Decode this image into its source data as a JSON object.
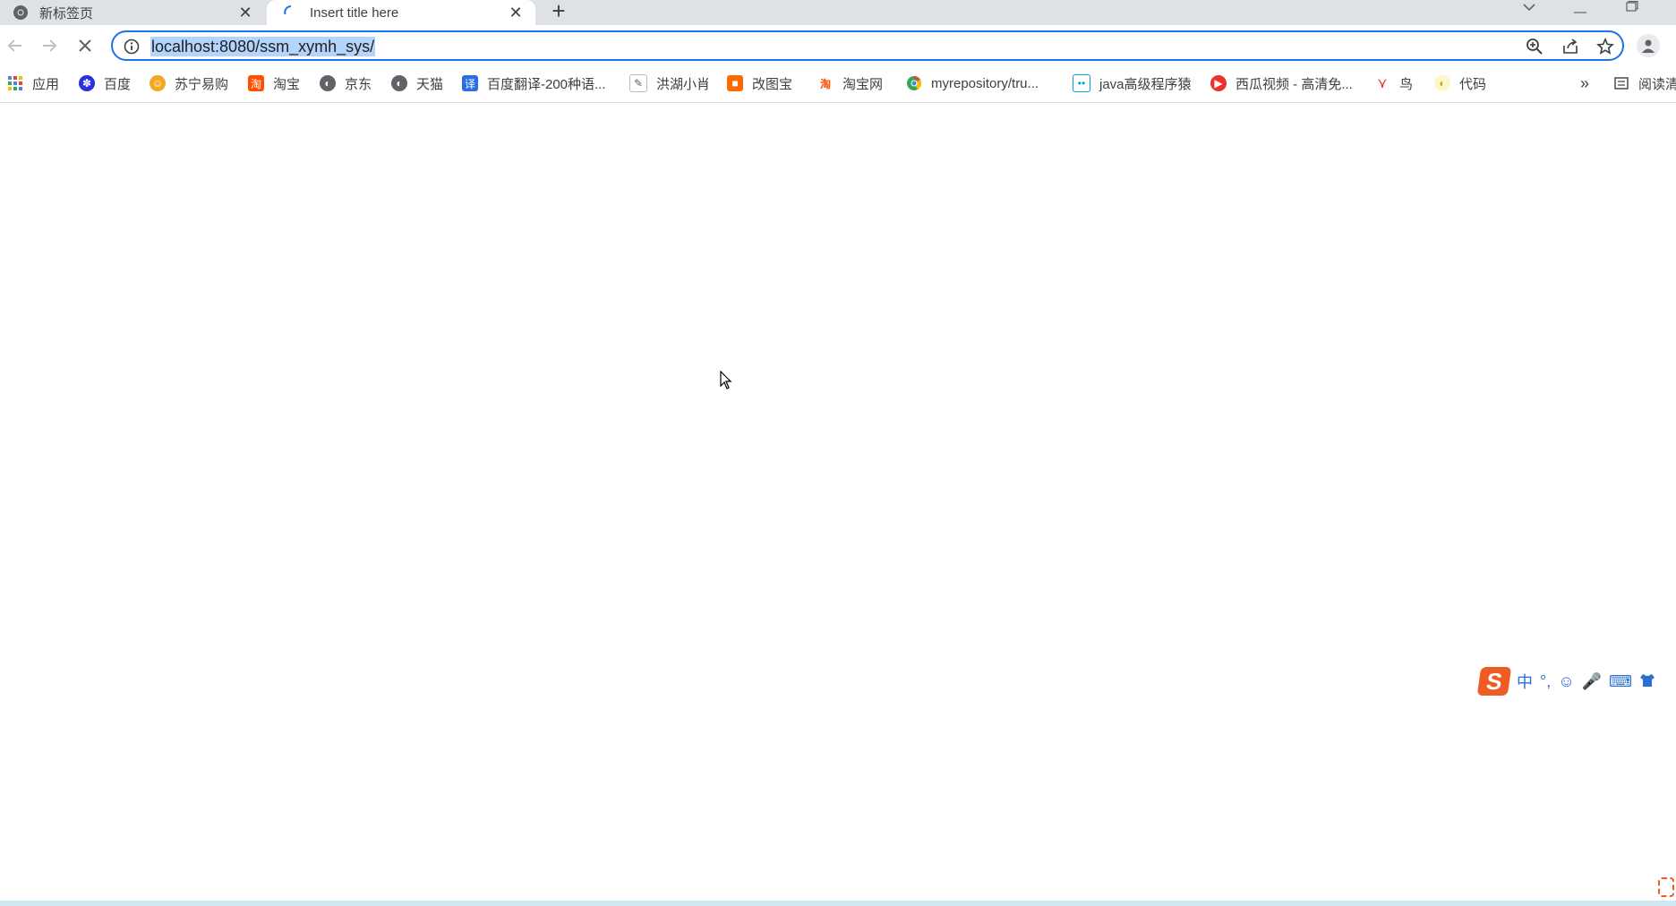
{
  "tabs": [
    {
      "title": "新标签页",
      "close": "✕"
    },
    {
      "title": "Insert title here",
      "close": "✕"
    }
  ],
  "new_tab": "+",
  "address_bar": {
    "url": "localhost:8080/ssm_xymh_sys/"
  },
  "bookmarks": [
    {
      "label": "应用",
      "icon": "apps-grid-icon",
      "color": "#4285f4"
    },
    {
      "label": "百度",
      "icon": "baidu-paw-icon",
      "color": "#2932e1"
    },
    {
      "label": "苏宁易购",
      "icon": "suning-icon",
      "color": "#f5a623"
    },
    {
      "label": "淘宝",
      "icon": "taobao-icon",
      "color": "#ff5000"
    },
    {
      "label": "京东",
      "icon": "globe-icon",
      "color": "#5f6368"
    },
    {
      "label": "天猫",
      "icon": "globe-icon",
      "color": "#5f6368"
    },
    {
      "label": "百度翻译-200种语...",
      "icon": "translate-icon",
      "color": "#2b6de5"
    },
    {
      "label": "洪湖小肖",
      "icon": "pen-icon",
      "color": "#5f6368"
    },
    {
      "label": "改图宝",
      "icon": "gaitubao-icon",
      "color": "#ff6a00"
    },
    {
      "label": "淘宝网",
      "icon": "taobao-tao-icon",
      "color": "#ff5000"
    },
    {
      "label": "myrepository/tru...",
      "icon": "chrome-icon",
      "color": "#34a853"
    },
    {
      "label": "java高级程序猿",
      "icon": "bilibili-icon",
      "color": "#00a1d6"
    },
    {
      "label": "西瓜视频 - 高清免...",
      "icon": "xigua-play-icon",
      "color": "#f0302b"
    },
    {
      "label": "鸟",
      "icon": "bird-icon",
      "color": "#e53935"
    },
    {
      "label": "代码",
      "icon": "code-icon",
      "color": "#e8c14a"
    }
  ],
  "bookmarks_more": "»",
  "reading_list": "阅读清",
  "ime_toolbar": {
    "logo": "S",
    "items": [
      "中",
      "°,",
      "☺",
      "🎤",
      "⌨"
    ]
  }
}
